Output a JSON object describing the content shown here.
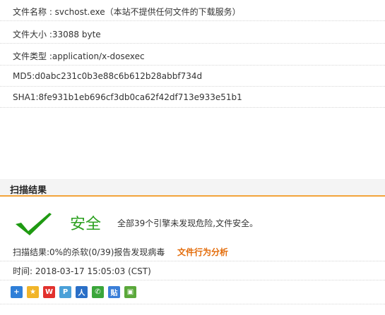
{
  "file_info": {
    "name": "文件名称 : svchost.exe（本站不提供任何文件的下载服务）",
    "size": "文件大小 :33088 byte",
    "type": "文件类型 :application/x-dosexec",
    "md5": "MD5:d0abc231c0b3e88c6b612b28abbf734d",
    "sha1": "SHA1:8fe931b1eb696cf3db0ca62f42df713e933e51b1"
  },
  "scan": {
    "section_title": "扫描结果",
    "verdict": "安全",
    "verdict_desc": "全部39个引擎未发现危险,文件安全。",
    "summary": "扫描结果:0%的杀软(0/39)报告发现病毒",
    "behavior_link": "文件行为分析",
    "time": "时间: 2018-03-17 15:05:03 (CST)"
  },
  "colors": {
    "accent_orange": "#f2a33a",
    "safe_green": "#2ba01f",
    "link_orange": "#e36c0a"
  },
  "share_icons": [
    {
      "name": "share-more-icon",
      "glyph": "+",
      "color": "#2f7fd8"
    },
    {
      "name": "qzone-icon",
      "glyph": "★",
      "color": "#f1b52a"
    },
    {
      "name": "weibo-icon",
      "glyph": "W",
      "color": "#e2312d"
    },
    {
      "name": "tencent-weibo-icon",
      "glyph": "P",
      "color": "#4aa0d8"
    },
    {
      "name": "renren-icon",
      "glyph": "人",
      "color": "#2a6fc7"
    },
    {
      "name": "wechat-icon",
      "glyph": "✆",
      "color": "#3aa63a"
    },
    {
      "name": "tieba-icon",
      "glyph": "贴",
      "color": "#3b7fd8"
    },
    {
      "name": "photo-share-icon",
      "glyph": "▣",
      "color": "#5aa83a"
    }
  ]
}
